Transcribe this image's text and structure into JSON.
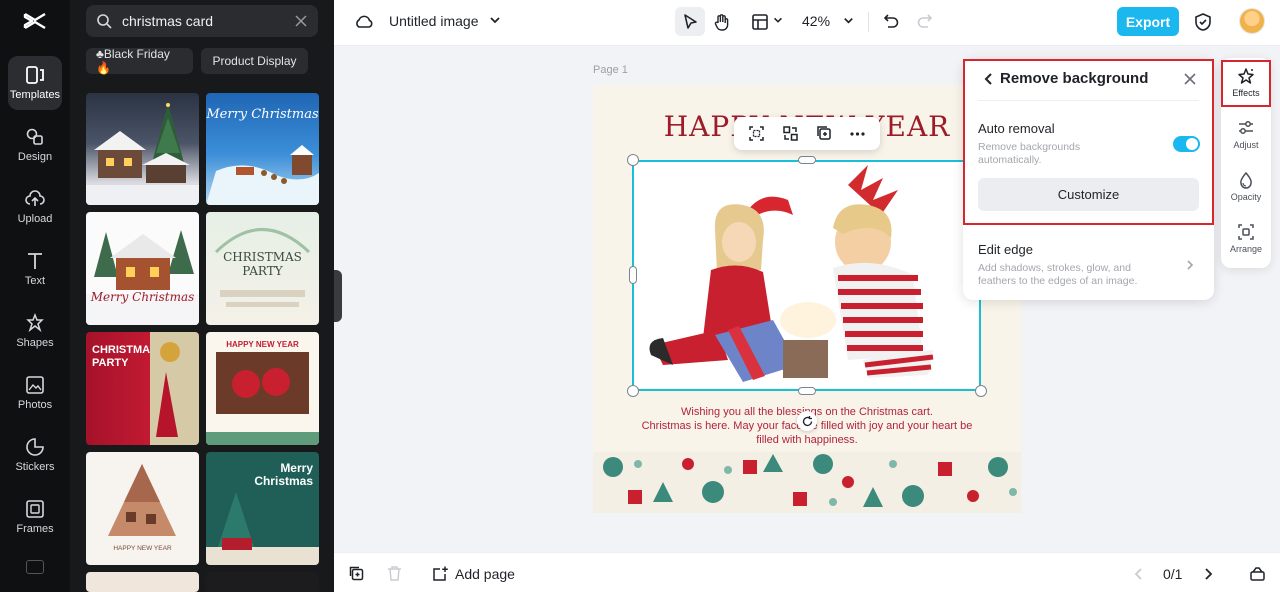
{
  "app": {
    "document_title": "Untitled image",
    "zoom": "42%",
    "export_label": "Export",
    "brand_color": "#1bb7ef"
  },
  "rail": {
    "items": [
      {
        "label": "Templates",
        "icon": "templates-icon",
        "active": true
      },
      {
        "label": "Design",
        "icon": "design-icon"
      },
      {
        "label": "Upload",
        "icon": "upload-icon"
      },
      {
        "label": "Text",
        "icon": "text-icon"
      },
      {
        "label": "Shapes",
        "icon": "shapes-icon"
      },
      {
        "label": "Photos",
        "icon": "photos-icon"
      },
      {
        "label": "Stickers",
        "icon": "stickers-icon"
      },
      {
        "label": "Frames",
        "icon": "frames-icon"
      }
    ]
  },
  "panel": {
    "search_value": "christmas card",
    "chips": [
      "♣Black Friday🔥",
      "Product Display"
    ],
    "templates": [
      {
        "caption": ""
      },
      {
        "caption": "Merry Christmas"
      },
      {
        "caption": "Merry Christmas"
      },
      {
        "caption": "CHRISTMAS PARTY"
      },
      {
        "caption": "CHRISTMAS PARTY"
      },
      {
        "caption": "HAPPY NEW YEAR"
      },
      {
        "caption": "HAPPY NEW YEAR"
      },
      {
        "caption": "Merry Christmas"
      }
    ]
  },
  "canvas": {
    "page_label": "Page 1",
    "headline": "HAPPY NEW YEAR",
    "greeting_lines": [
      "Wishing you all the blessings on the Christmas cart.",
      "Christmas is here. May your face be filled with joy and your heart be",
      "filled with happiness."
    ]
  },
  "remove_bg": {
    "title": "Remove background",
    "auto_label": "Auto removal",
    "auto_sub": "Remove backgrounds automatically.",
    "auto_enabled": true,
    "customize_label": "Customize",
    "edge_label": "Edit edge",
    "edge_sub": "Add shadows, strokes, glow, and feathers to the edges of an image."
  },
  "side_tools": [
    {
      "label": "Effects",
      "icon": "effects-icon",
      "active": true
    },
    {
      "label": "Adjust",
      "icon": "adjust-icon"
    },
    {
      "label": "Opacity",
      "icon": "opacity-icon"
    },
    {
      "label": "Arrange",
      "icon": "arrange-icon"
    }
  ],
  "bottom": {
    "add_page_label": "Add page",
    "page_counter": "0/1"
  }
}
